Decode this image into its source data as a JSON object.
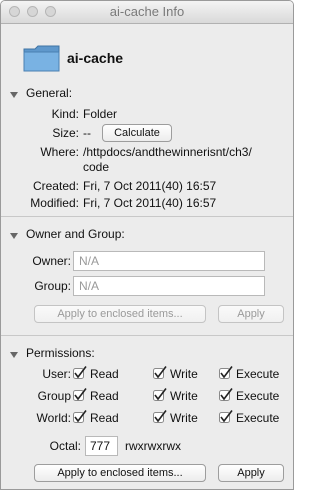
{
  "window": {
    "title": "ai-cache Info"
  },
  "header": {
    "name": "ai-cache"
  },
  "general": {
    "title": "General:",
    "kind_label": "Kind:",
    "kind_value": "Folder",
    "size_label": "Size:",
    "size_value": "--",
    "calculate_button": "Calculate",
    "where_label": "Where:",
    "where_value_line1": "/httpdocs/andthewinnerisnt/ch3/",
    "where_value_line2": "code",
    "created_label": "Created:",
    "created_value": "Fri, 7 Oct 2011(40) 16:57",
    "modified_label": "Modified:",
    "modified_value": "Fri, 7 Oct 2011(40) 16:57"
  },
  "owner_group": {
    "title": "Owner and Group:",
    "owner_label": "Owner:",
    "owner_value": "N/A",
    "group_label": "Group:",
    "group_value": "N/A",
    "apply_enclosed_button": "Apply to enclosed items...",
    "apply_button": "Apply"
  },
  "permissions": {
    "title": "Permissions:",
    "rows": [
      {
        "label": "User:",
        "read": "Read",
        "write": "Write",
        "execute": "Execute"
      },
      {
        "label": "Group",
        "read": "Read",
        "write": "Write",
        "execute": "Execute"
      },
      {
        "label": "World:",
        "read": "Read",
        "write": "Write",
        "execute": "Execute"
      }
    ],
    "octal_label": "Octal:",
    "octal_value": "777",
    "symbolic_value": "rwxrwxrwx",
    "apply_enclosed_button": "Apply to enclosed items...",
    "apply_button": "Apply"
  },
  "icons": {
    "folder": "folder-icon",
    "checkbox": "checkmark-icon",
    "disclosure": "disclosure-triangle-icon"
  },
  "colors": {
    "window_bg": "#ececec",
    "folder_blue": "#6fa7d8"
  }
}
